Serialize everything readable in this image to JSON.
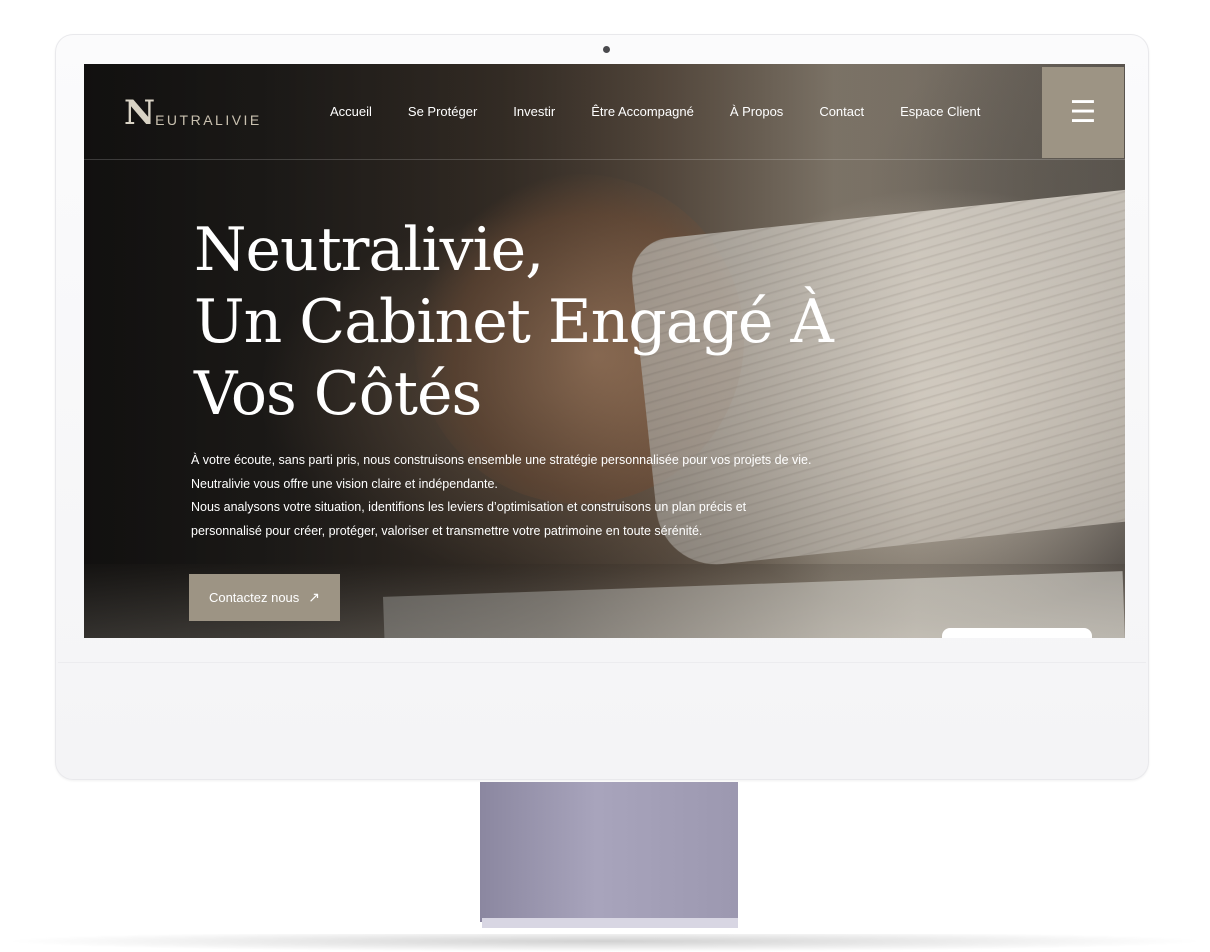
{
  "brand": {
    "logo_mark": "N",
    "logo_text": "EUTRALIVIE"
  },
  "nav": {
    "items": [
      {
        "label": "Accueil"
      },
      {
        "label": "Se Protéger"
      },
      {
        "label": "Investir"
      },
      {
        "label": "Être Accompagné"
      },
      {
        "label": "À Propos"
      },
      {
        "label": "Contact"
      },
      {
        "label": "Espace Client"
      }
    ],
    "menu_icon": "hamburger-icon",
    "menu_glyph": "☰"
  },
  "hero": {
    "title_lines": [
      "Neutralivie,",
      "Un Cabinet Engagé À",
      "Vos Côtés"
    ],
    "body_lines": [
      "À votre écoute, sans parti pris, nous construisons ensemble une stratégie personnalisée pour vos projets de vie.",
      "Neutralivie vous offre une vision claire et indépendante.",
      "Nous analysons votre situation, identifions les leviers d’optimisation et construisons un plan précis et",
      "personnalisé pour créer, protéger, valoriser et transmettre votre patrimoine en toute sérénité."
    ],
    "cta_label": "Contactez nous",
    "cta_icon": "arrow-up-right-icon",
    "cta_glyph": "↗"
  },
  "colors": {
    "accent": "#9d9484",
    "logo": "#d9d3c5",
    "text": "#ffffff"
  }
}
